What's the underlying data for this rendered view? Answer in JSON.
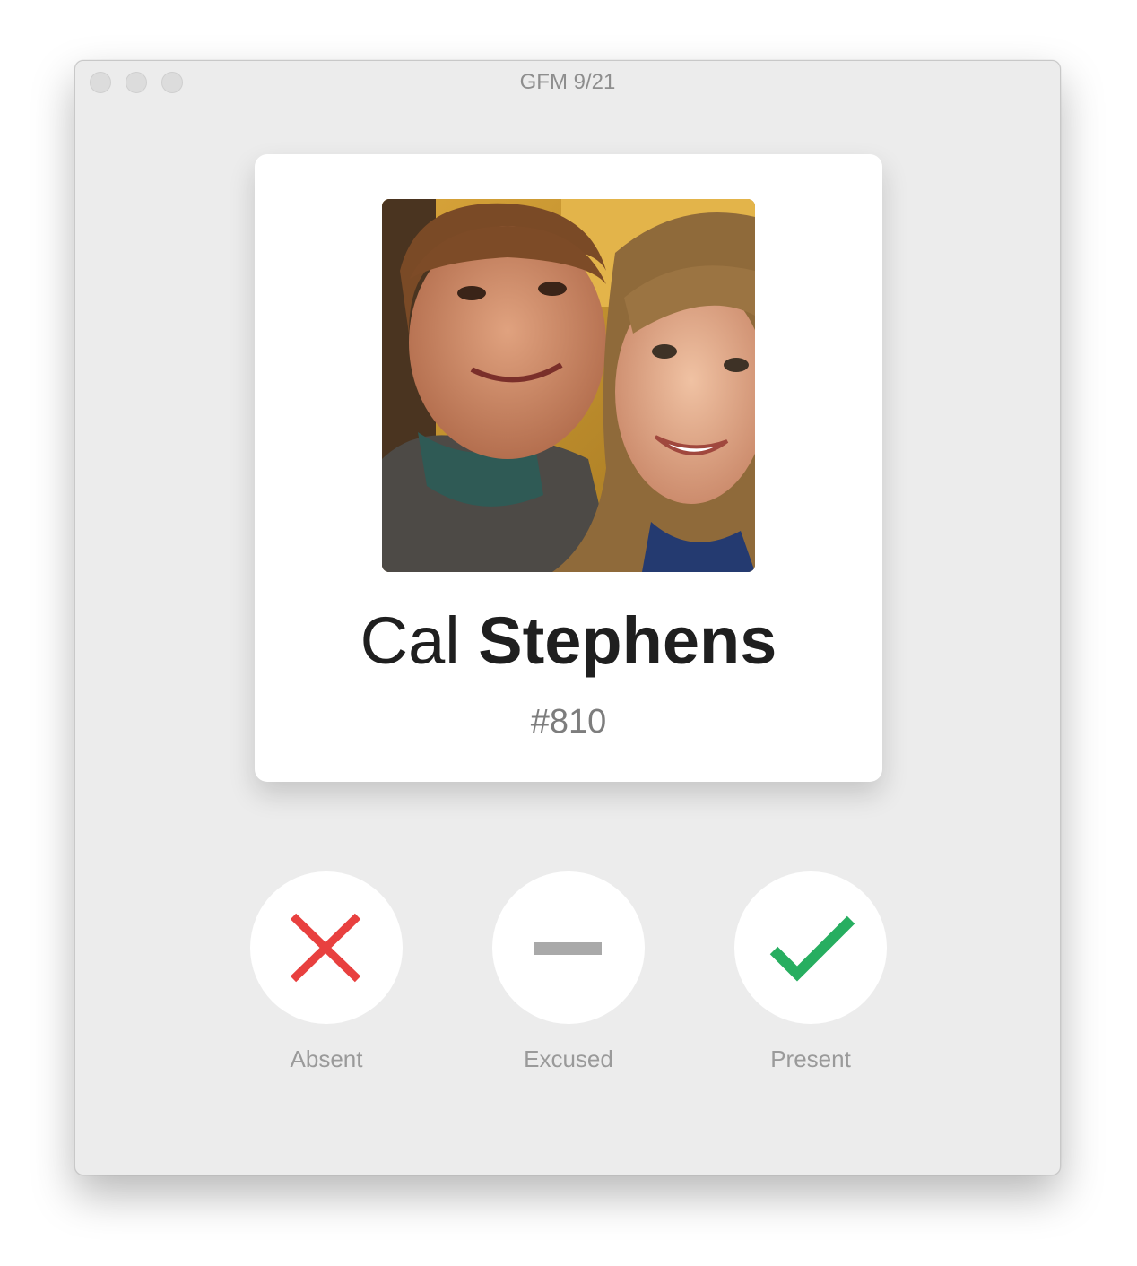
{
  "window": {
    "title": "GFM 9/21"
  },
  "student": {
    "first_name": "Cal",
    "last_name": "Stephens",
    "number": "#810"
  },
  "actions": [
    {
      "label": "Absent",
      "icon": "x-icon",
      "color": "#e8403f"
    },
    {
      "label": "Excused",
      "icon": "minus-icon",
      "color": "#a9a9a9"
    },
    {
      "label": "Present",
      "icon": "checkmark-icon",
      "color": "#27ae60"
    }
  ]
}
